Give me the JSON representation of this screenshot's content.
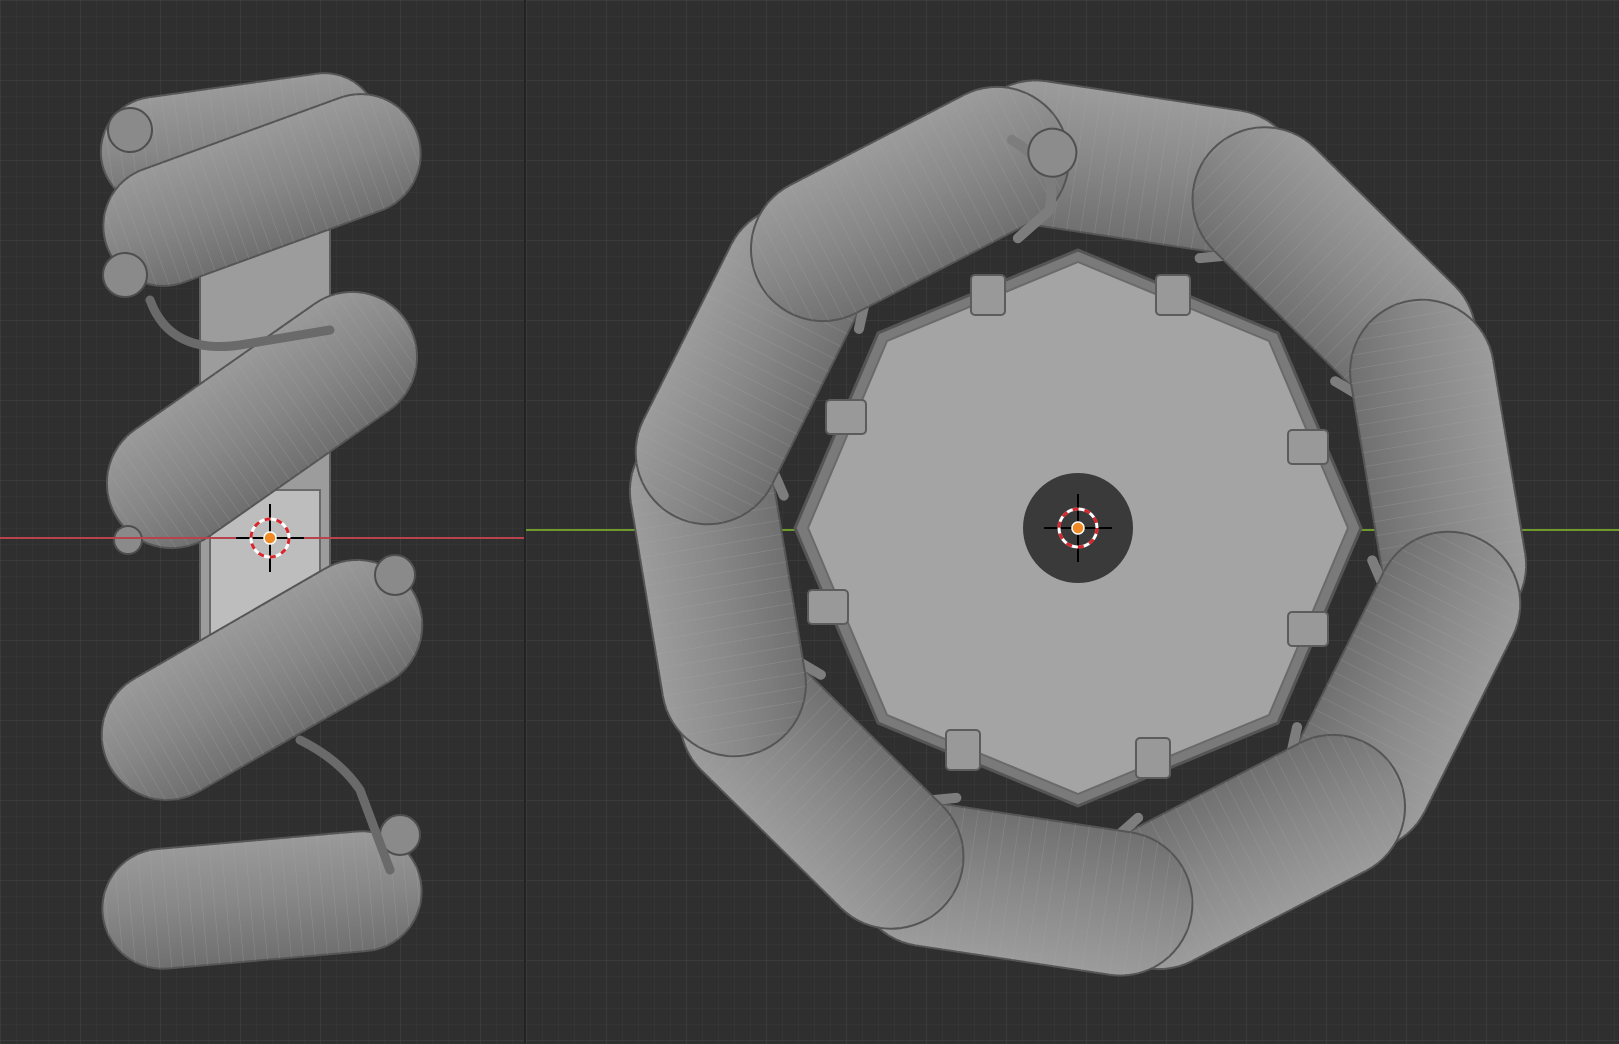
{
  "viewports": [
    {
      "view": "side",
      "axis_line_color": "#b8434f",
      "grid_minor_color": "#393939",
      "grid_major_color": "#444444"
    },
    {
      "view": "front",
      "axis_line_color": "#6e9a2b",
      "grid_minor_color": "#393939",
      "grid_major_color": "#444444"
    }
  ],
  "model": {
    "roller_count": 10,
    "roller_color": "#8e8e8e",
    "hub_color": "#a4a4a4",
    "bracket_color": "#7d7d7d"
  },
  "cursor": {
    "icon": "3d-cursor-icon",
    "ring_color_a": "#d9262c",
    "ring_color_b": "#ffffff",
    "origin_color": "#f08a24"
  }
}
